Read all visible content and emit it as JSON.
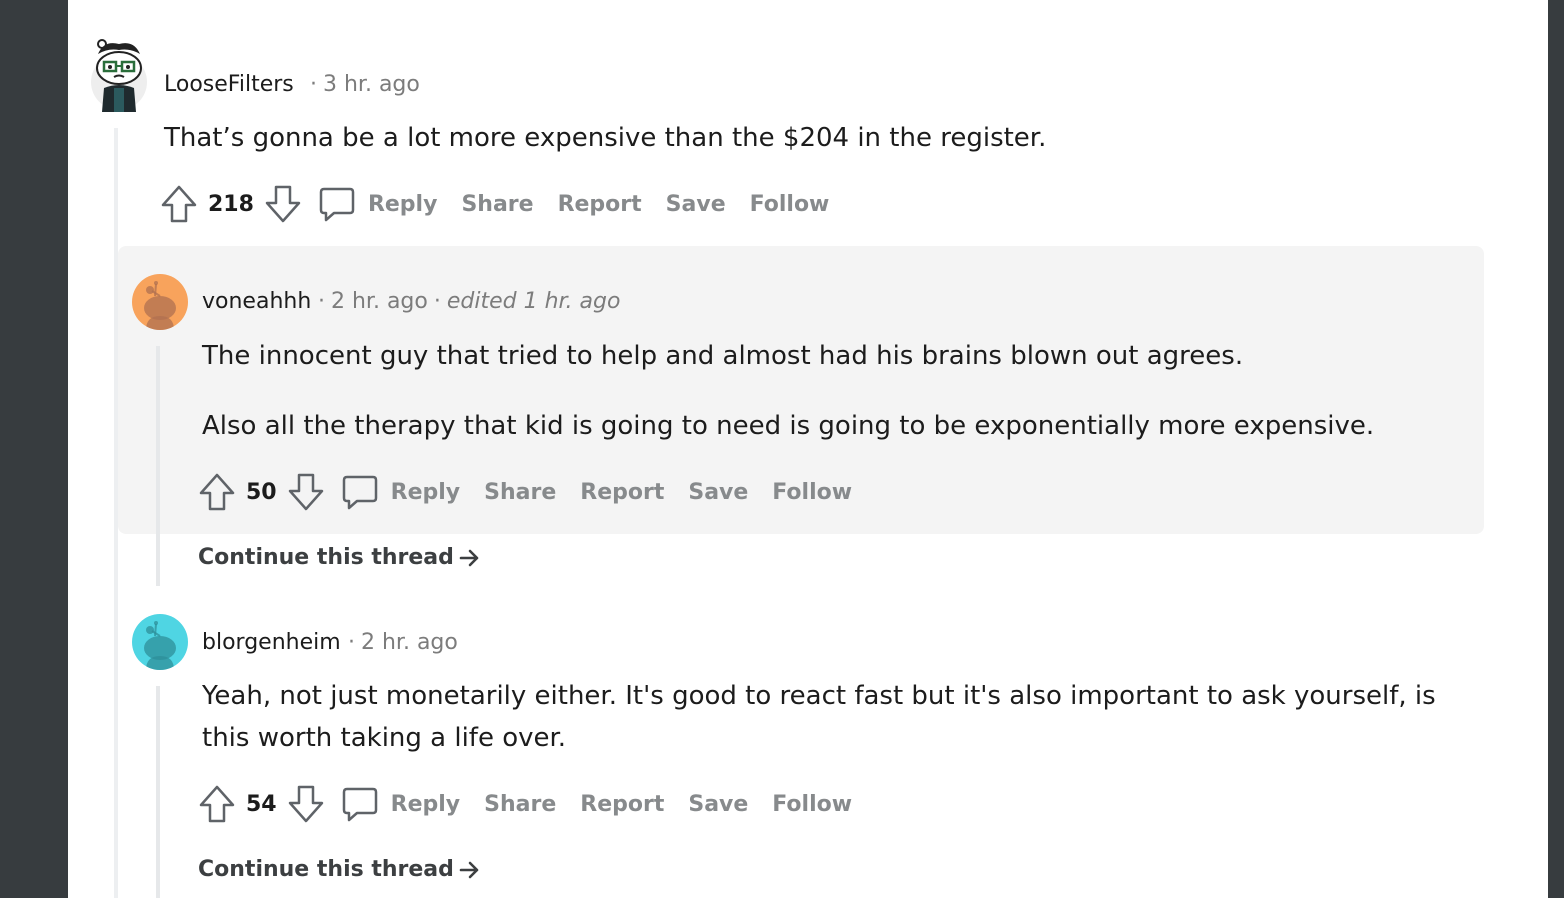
{
  "comments": [
    {
      "username": "LooseFilters",
      "time": "3 hr. ago",
      "text": [
        "That’s gonna be a lot more expensive than the $204 in the register."
      ],
      "votes": "218",
      "actions": [
        "Reply",
        "Share",
        "Report",
        "Save",
        "Follow"
      ]
    },
    {
      "username": "voneahhh",
      "time": "2 hr. ago",
      "edited": "edited 1 hr. ago",
      "text": [
        "The innocent guy that tried to help and almost had his brains blown out agrees.",
        "Also all the therapy that kid is going to need is going to be exponentially more expensive."
      ],
      "votes": "50",
      "actions": [
        "Reply",
        "Share",
        "Report",
        "Save",
        "Follow"
      ],
      "continue": "Continue this thread"
    },
    {
      "username": "blorgenheim",
      "time": "2 hr. ago",
      "text": [
        "Yeah, not just monetarily either. It's good to react fast but it's also important to ask yourself, is",
        "this worth taking a life over."
      ],
      "votes": "54",
      "actions": [
        "Reply",
        "Share",
        "Report",
        "Save",
        "Follow"
      ],
      "continue": "Continue this thread"
    }
  ],
  "colors": {
    "background": "#373c3f",
    "card": "#ffffff",
    "highlight": "#f4f4f4",
    "muted": "#878a8c",
    "avatar_orange": "#f8a35c",
    "avatar_cyan": "#4fd5e3"
  },
  "sep": "·"
}
